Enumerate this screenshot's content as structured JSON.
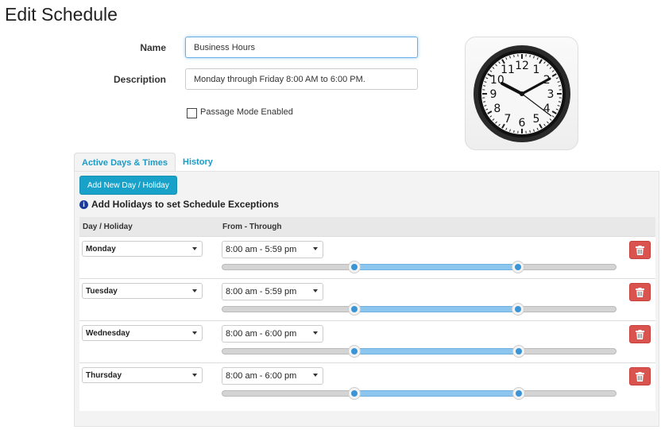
{
  "page": {
    "title": "Edit Schedule"
  },
  "form": {
    "name_label": "Name",
    "name_value": "Business Hours",
    "description_label": "Description",
    "description_value": "Monday through Friday 8:00 AM to 6:00 PM.",
    "passage_mode_label": "Passage Mode Enabled",
    "passage_mode_checked": false
  },
  "tabs": [
    {
      "label": "Active Days & Times",
      "active": true
    },
    {
      "label": "History",
      "active": false
    }
  ],
  "panel": {
    "add_button_label": "Add New Day / Holiday",
    "info_text": "Add Holidays to set Schedule Exceptions",
    "columns": [
      "Day / Holiday",
      "From - Through"
    ]
  },
  "rows": [
    {
      "day": "Monday",
      "range": "8:00 am - 5:59 pm",
      "from_hour": 8,
      "to_hour": 17.98
    },
    {
      "day": "Tuesday",
      "range": "8:00 am - 5:59 pm",
      "from_hour": 8,
      "to_hour": 17.98
    },
    {
      "day": "Wednesday",
      "range": "8:00 am - 6:00 pm",
      "from_hour": 8,
      "to_hour": 18
    },
    {
      "day": "Thursday",
      "range": "8:00 am - 6:00 pm",
      "from_hour": 8,
      "to_hour": 18
    }
  ],
  "icons": {
    "clock": "clock-icon",
    "info": "info-icon",
    "delete": "trash-icon",
    "caret": "caret-down-icon"
  },
  "colors": {
    "accent": "#19a2c9",
    "danger": "#d9534f",
    "slider_range": "#8cc6ee",
    "slider_knob": "#3a94d6"
  }
}
